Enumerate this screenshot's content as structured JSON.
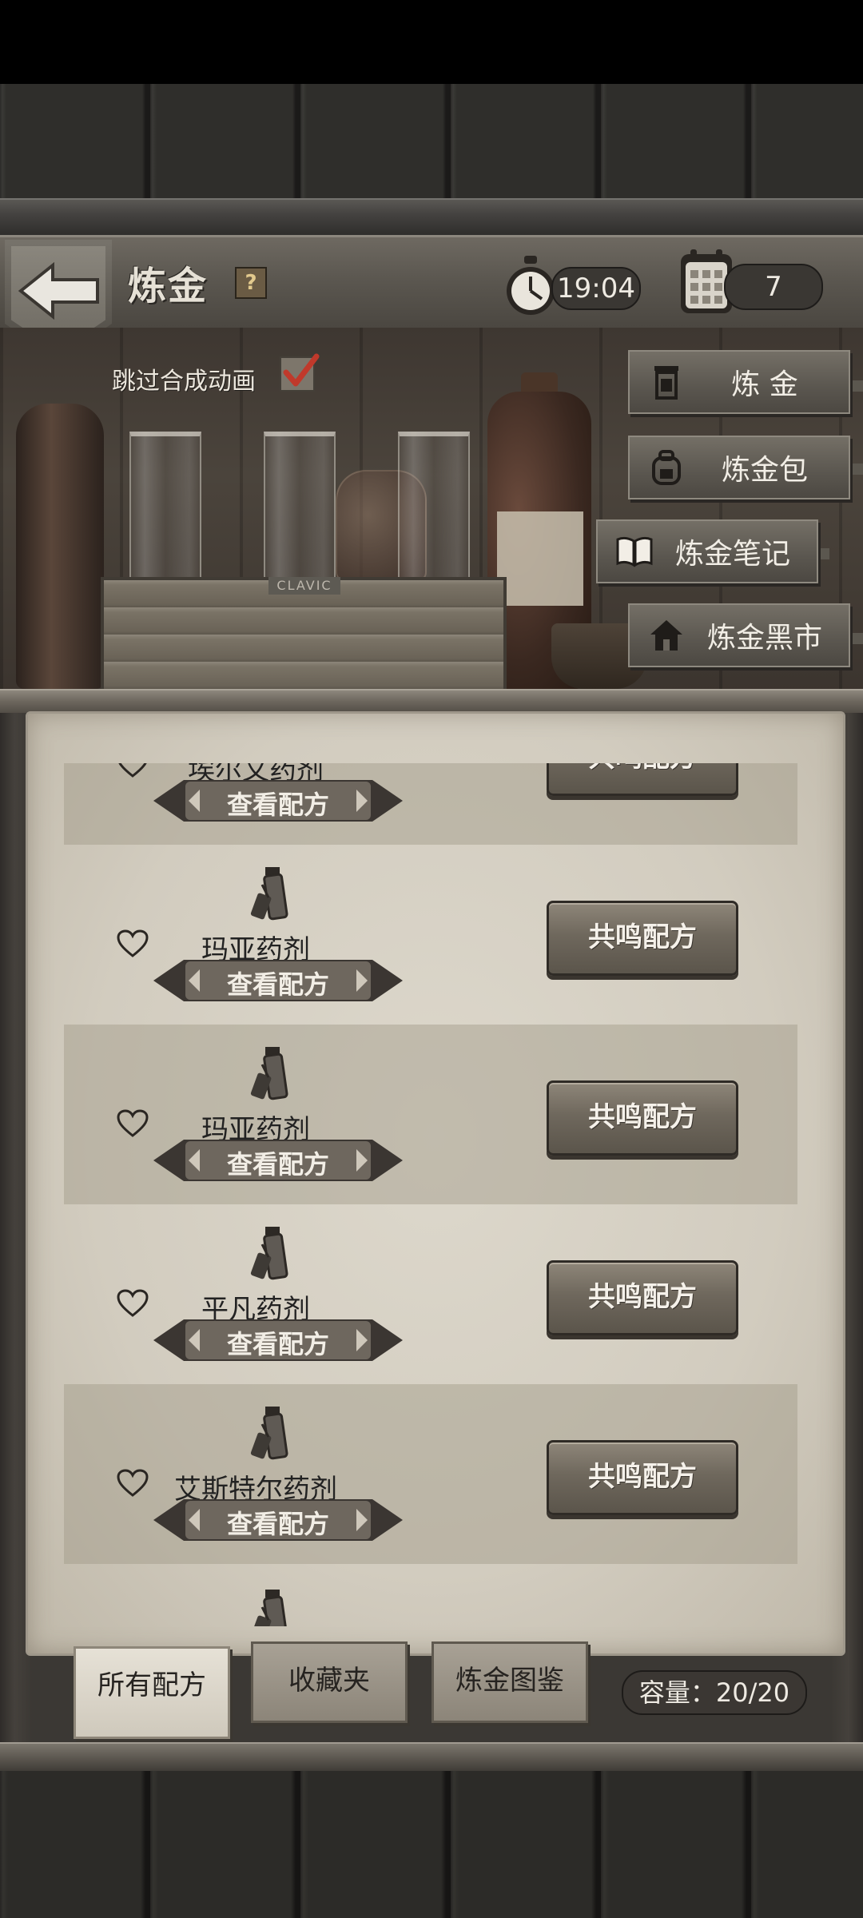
{
  "header": {
    "title": "炼金",
    "help_label": "?",
    "time": "19:04",
    "day": "7"
  },
  "shelf": {
    "skip_animation_label": "跳过合成动画",
    "skip_animation_checked": true,
    "crate_label": "CLAVIC"
  },
  "side_menu": {
    "alchemy": "炼 金",
    "alchemy_bag": "炼金包",
    "alchemy_notes": "炼金笔记",
    "black_market": "炼金黑市"
  },
  "recipes": [
    {
      "name": "埃尔文药剂",
      "view_label": "查看配方",
      "resonate_label": "共鸣配方",
      "favorited": false
    },
    {
      "name": "玛亚药剂",
      "view_label": "查看配方",
      "resonate_label": "共鸣配方",
      "favorited": false
    },
    {
      "name": "玛亚药剂",
      "view_label": "查看配方",
      "resonate_label": "共鸣配方",
      "favorited": false
    },
    {
      "name": "平凡药剂",
      "view_label": "查看配方",
      "resonate_label": "共鸣配方",
      "favorited": false
    },
    {
      "name": "艾斯特尔药剂",
      "view_label": "查看配方",
      "resonate_label": "共鸣配方",
      "favorited": false
    },
    {
      "name": "",
      "view_label": "",
      "resonate_label": "",
      "favorited": false
    }
  ],
  "tabs": {
    "all_recipes": "所有配方",
    "favorites": "收藏夹",
    "codex": "炼金图鉴",
    "active": "all_recipes"
  },
  "capacity": "容量：20/20",
  "colors": {
    "parchment": "#d2ccbf",
    "wood_dark": "#2f2e2b",
    "button_wood": "#6f685d",
    "checkmark": "#c0392b"
  }
}
